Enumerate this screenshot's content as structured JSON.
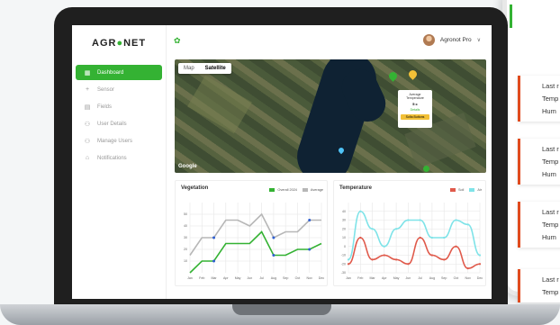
{
  "phone": {
    "cards": [
      {
        "lines": [
          "Last r",
          "Temp",
          "Hum"
        ]
      },
      {
        "lines": [
          "Last r",
          "Temp",
          "Hum"
        ]
      },
      {
        "lines": [
          "Last r",
          "Temp",
          "Hum"
        ]
      },
      {
        "lines": [
          "Last r",
          "Temp"
        ]
      }
    ]
  },
  "app": {
    "logo_left": "AGR",
    "logo_o": "●",
    "logo_right": "NET",
    "user_name": "Agronot Pro",
    "chevron": "∨"
  },
  "sidebar": {
    "items": [
      {
        "label": "Dashboard",
        "icon": "grid-icon",
        "glyph": "▦",
        "active": true
      },
      {
        "label": "Sensor",
        "icon": "plus-icon",
        "glyph": "+",
        "active": false
      },
      {
        "label": "Fields",
        "icon": "fields-icon",
        "glyph": "▤",
        "active": false
      },
      {
        "label": "User Details",
        "icon": "user-icon",
        "glyph": "⚇",
        "active": false
      },
      {
        "label": "Manage Users",
        "icon": "users-icon",
        "glyph": "⚇",
        "active": false
      },
      {
        "label": "Notifications",
        "icon": "bell-icon",
        "glyph": "⌂",
        "active": false
      }
    ]
  },
  "map": {
    "tab_map": "Map",
    "tab_satellite": "Satellite",
    "google_label": "Google",
    "popup": {
      "title": "Average Temperature",
      "value": "5 c",
      "status": "Details",
      "button": "Sofia Buttons"
    }
  },
  "vegetation": {
    "title": "Vegetation",
    "colors": {
      "series1": "#34b233",
      "series2": "#b7b7b7"
    }
  },
  "temperature": {
    "title": "Temperature",
    "colors": {
      "series1": "#e05a4b",
      "series2": "#7fe3e8"
    }
  },
  "chart_data": [
    {
      "type": "line",
      "title": "Vegetation",
      "categories": [
        "Jan",
        "Feb",
        "Mar",
        "Apr",
        "May",
        "Jun",
        "Jul",
        "Aug",
        "Sep",
        "Oct",
        "Nov",
        "Dec"
      ],
      "ylim": [
        0,
        60
      ],
      "yticks": [
        10,
        20,
        30,
        40,
        50
      ],
      "series": [
        {
          "name": "Overall 2024",
          "values": [
            0,
            10,
            10,
            25,
            25,
            25,
            35,
            15,
            15,
            20,
            20,
            25
          ]
        },
        {
          "name": "Average",
          "values": [
            15,
            30,
            30,
            45,
            45,
            40,
            50,
            30,
            35,
            35,
            45,
            45
          ]
        }
      ],
      "grid": true
    },
    {
      "type": "line",
      "title": "Temperature",
      "categories": [
        "Jan",
        "Feb",
        "Mar",
        "Apr",
        "May",
        "Jun",
        "Jul",
        "Aug",
        "Sep",
        "Oct",
        "Nov",
        "Dec"
      ],
      "ylim": [
        -30,
        50
      ],
      "yticks": [
        -30,
        -20,
        -10,
        0,
        10,
        20,
        30,
        40
      ],
      "series": [
        {
          "name": "Soil",
          "values": [
            -20,
            10,
            -15,
            -10,
            -15,
            -20,
            10,
            -10,
            -15,
            0,
            -25,
            -20
          ]
        },
        {
          "name": "Air",
          "values": [
            -15,
            40,
            20,
            0,
            20,
            30,
            30,
            10,
            10,
            30,
            25,
            -10
          ]
        }
      ],
      "grid": true
    }
  ]
}
